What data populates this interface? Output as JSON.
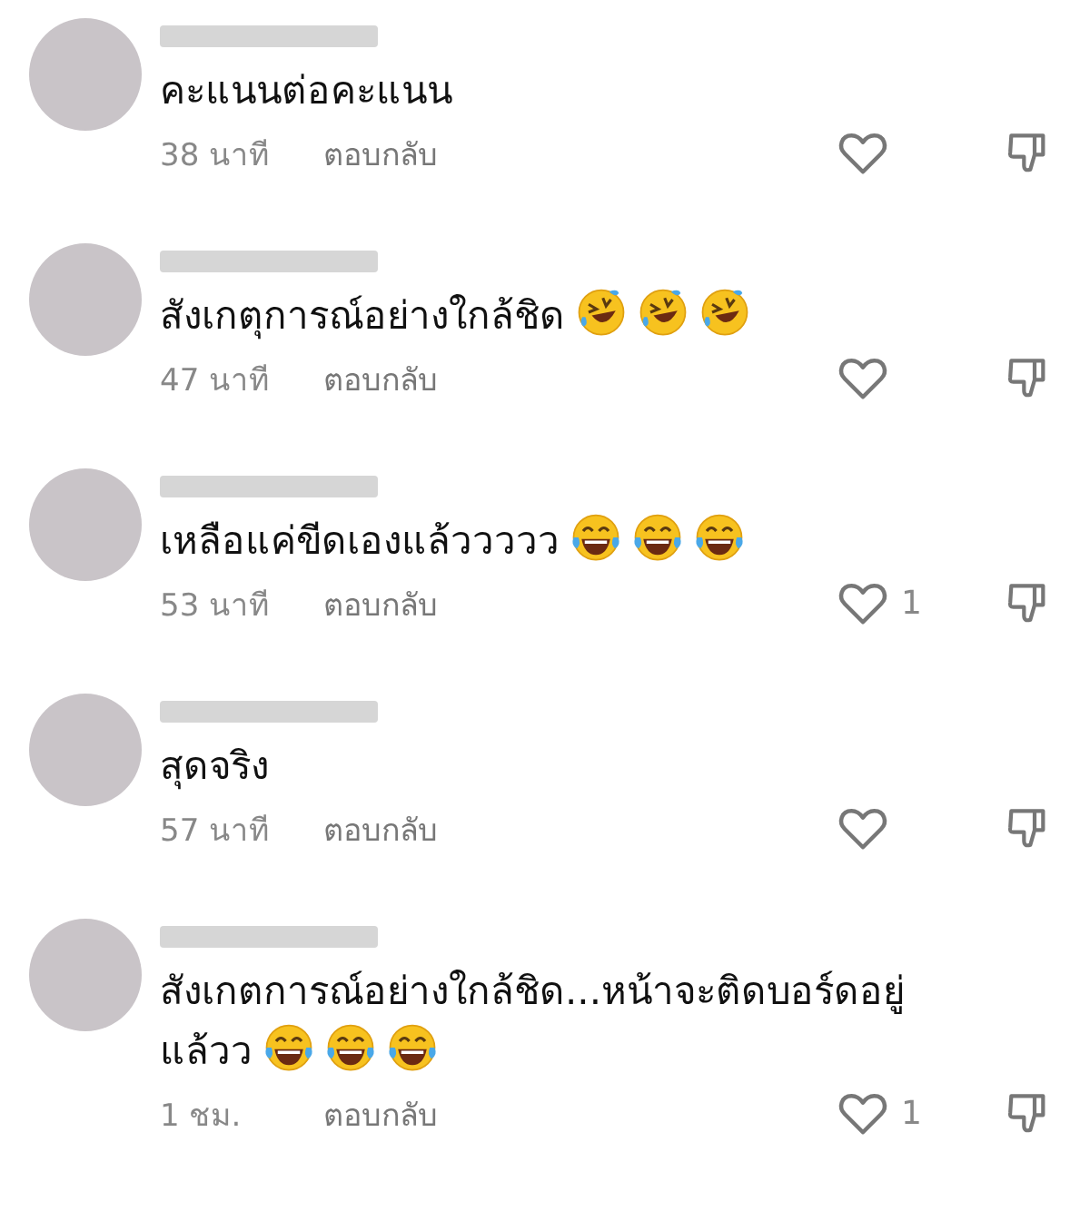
{
  "comments": [
    {
      "text": "คะแนนต่อคะแนน",
      "time": "38 นาที",
      "reply": "ตอบกลับ"
    },
    {
      "text": "สังเกตุการณ์อย่างใกล้ชิด",
      "emojis": [
        {
          "kind": "rofl"
        },
        {
          "kind": "rofl"
        },
        {
          "kind": "rofl"
        }
      ],
      "time": "47 นาที",
      "reply": "ตอบกลับ"
    },
    {
      "text": "เหลือแค่ขีดเองแล้ววววว",
      "emojis": [
        {
          "kind": "joy"
        },
        {
          "kind": "joy"
        },
        {
          "kind": "joy"
        }
      ],
      "time": "53 นาที",
      "reply": "ตอบกลับ",
      "likes": "1"
    },
    {
      "text": "สุดจริง",
      "time": "57 นาที",
      "reply": "ตอบกลับ"
    },
    {
      "text": "สังเกตการณ์อย่างใกล้ชิด...หน้าจะติดบอร์ดอยู่แล้วว",
      "emojis": [
        {
          "kind": "joy"
        },
        {
          "kind": "joy"
        },
        {
          "kind": "joy"
        }
      ],
      "time": "1 ชม.",
      "reply": "ตอบกลับ",
      "likes": "1"
    }
  ]
}
